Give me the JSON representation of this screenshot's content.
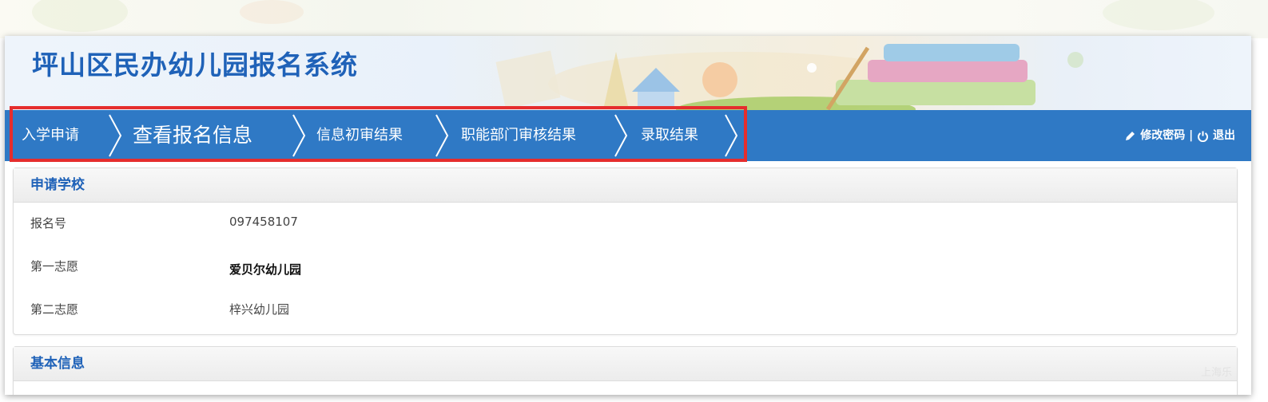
{
  "app": {
    "title": "坪山区民办幼儿园报名系统"
  },
  "nav": {
    "steps": [
      {
        "label": "入学申请"
      },
      {
        "label": "查看报名信息"
      },
      {
        "label": "信息初审结果"
      },
      {
        "label": "职能部门审核结果"
      },
      {
        "label": "录取结果"
      }
    ],
    "change_password": "修改密码",
    "separator": "|",
    "logout": "退出"
  },
  "school_panel": {
    "title": "申请学校",
    "rows": [
      {
        "label": "报名号",
        "value": "097458107"
      },
      {
        "label": "第一志愿",
        "value": "爱贝尔幼儿园"
      },
      {
        "label": "第二志愿",
        "value": "梓兴幼儿园"
      }
    ]
  },
  "basic_panel": {
    "title": "基本信息"
  },
  "watermark": "上海乐",
  "colors": {
    "nav_bg": "#2f79c5",
    "title": "#1f62b8",
    "highlight": "#e52d2d"
  }
}
